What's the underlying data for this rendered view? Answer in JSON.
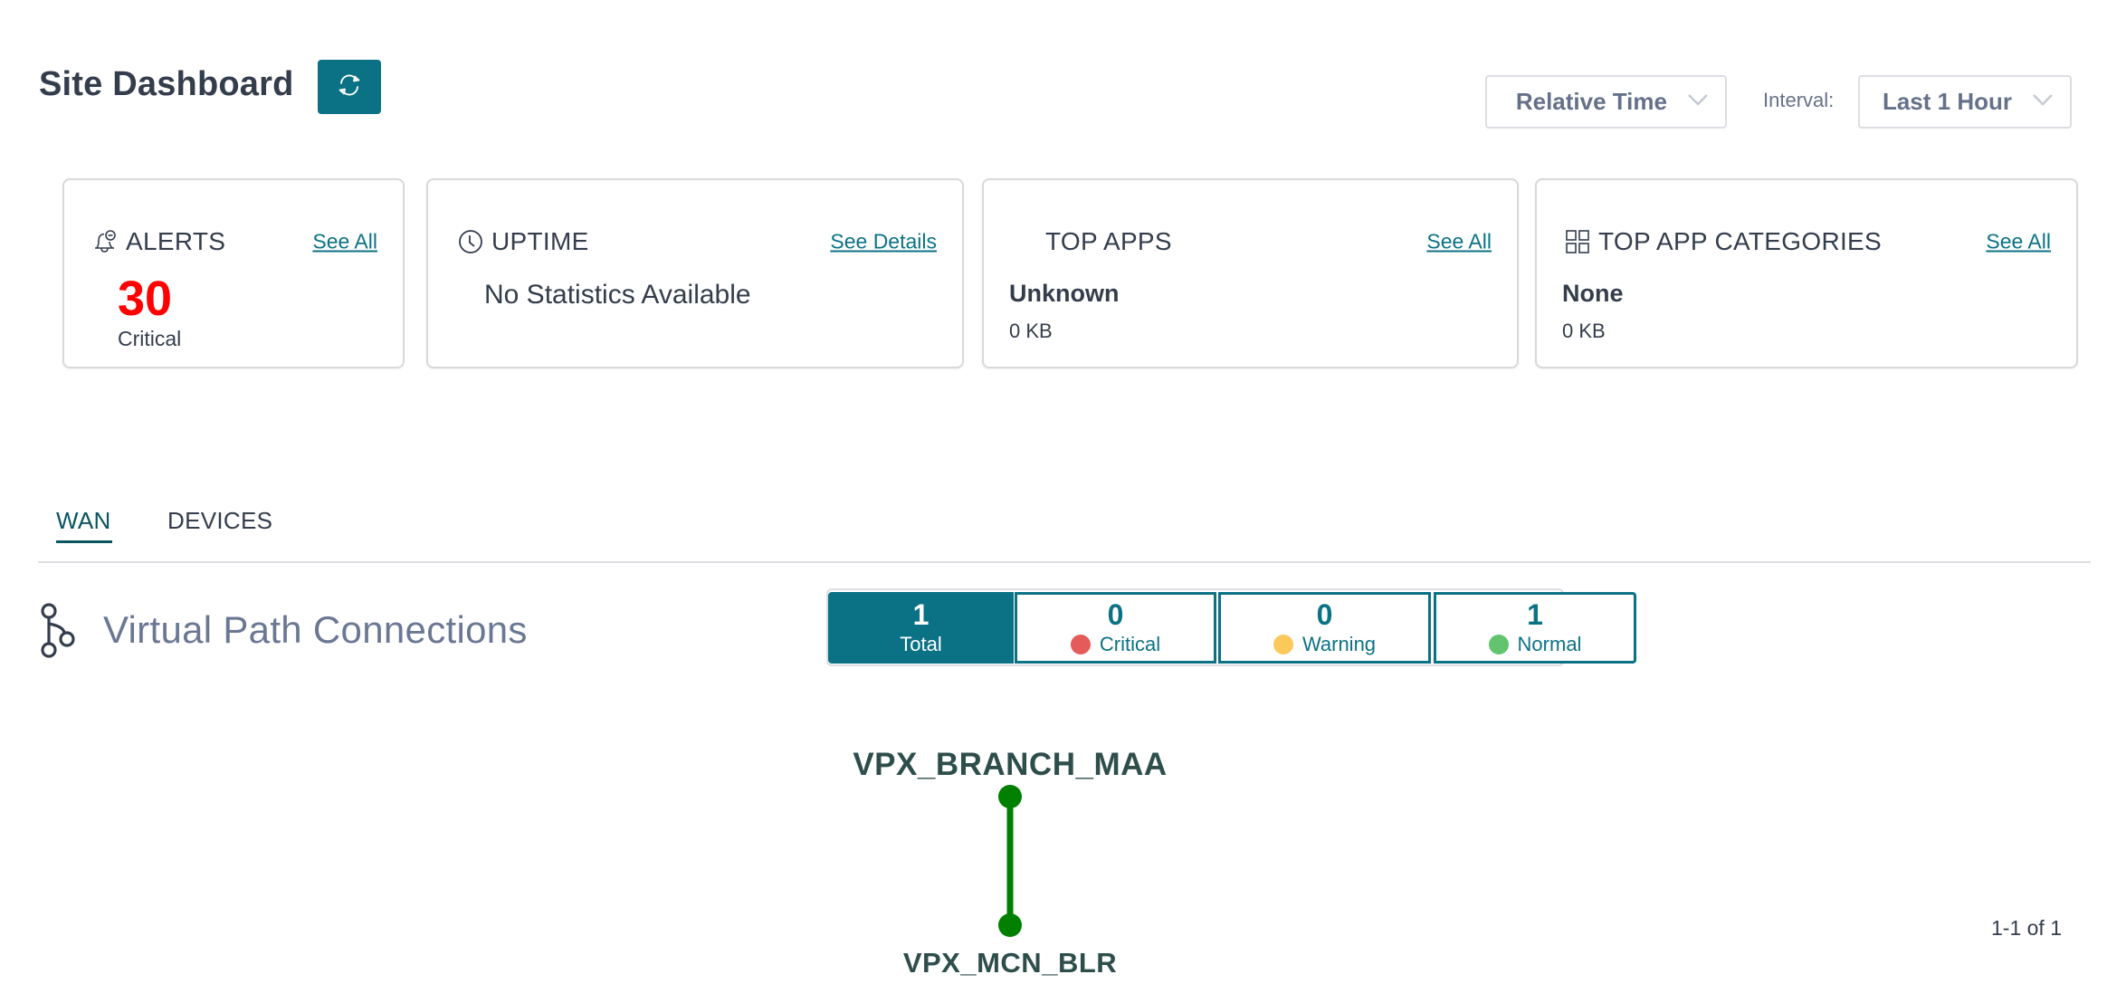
{
  "header": {
    "title": "Site Dashboard",
    "refresh_icon": "refresh-icon",
    "time_mode": {
      "selected": "Relative Time",
      "icon": "chevron-down-icon"
    },
    "interval_label": "Interval:",
    "interval": {
      "selected": "Last 1 Hour",
      "icon": "chevron-down-icon"
    }
  },
  "cards": {
    "alerts": {
      "icon": "bell-alert-icon",
      "title": "ALERTS",
      "link": "See All",
      "count": "30",
      "severity": "Critical"
    },
    "uptime": {
      "icon": "clock-icon",
      "title": "UPTIME",
      "link": "See Details",
      "message": "No Statistics Available"
    },
    "top_apps": {
      "title": "TOP APPS",
      "link": "See All",
      "item_name": "Unknown",
      "item_value": "0 KB"
    },
    "top_app_categories": {
      "icon": "grid-icon",
      "title": "TOP APP CATEGORIES",
      "link": "See All",
      "item_name": "None",
      "item_value": "0 KB"
    }
  },
  "tabs": [
    {
      "label": "WAN",
      "active": true
    },
    {
      "label": "DEVICES",
      "active": false
    }
  ],
  "section": {
    "icon": "branch-path-icon",
    "title": "Virtual Path Connections"
  },
  "status_filter": [
    {
      "key": "total",
      "count": "1",
      "label": "Total",
      "active": true
    },
    {
      "key": "critical",
      "count": "0",
      "label": "Critical",
      "color": "#e55a5a"
    },
    {
      "key": "warning",
      "count": "0",
      "label": "Warning",
      "color": "#fbc95a"
    },
    {
      "key": "normal",
      "count": "1",
      "label": "Normal",
      "color": "#62c46e"
    }
  ],
  "topology": {
    "nodes": [
      {
        "id": "VPX_BRANCH_MAA",
        "label": "VPX_BRANCH_MAA"
      },
      {
        "id": "VPX_MCN_BLR",
        "label": "VPX_MCN_BLR"
      }
    ],
    "links": [
      {
        "source": "VPX_BRANCH_MAA",
        "target": "VPX_MCN_BLR",
        "status": "normal",
        "color": "#007f00"
      }
    ]
  },
  "pagination": {
    "text": "1-1 of 1"
  },
  "colors": {
    "accent": "#0b7285",
    "critical_count": "#ff0000",
    "link_normal": "#007f00"
  }
}
